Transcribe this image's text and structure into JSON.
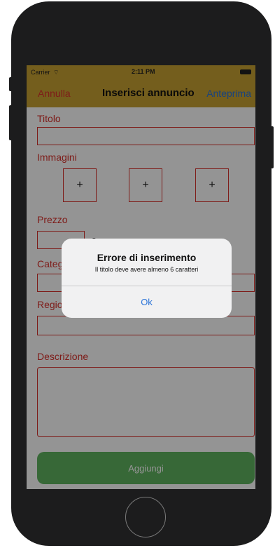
{
  "status_bar": {
    "carrier": "Carrier",
    "time": "2:11 PM"
  },
  "nav": {
    "left": "Annulla",
    "title": "Inserisci annuncio",
    "right": "Anteprima"
  },
  "form": {
    "titolo_label": "Titolo",
    "immagini_label": "Immagini",
    "image_slots": [
      "+",
      "+",
      "+"
    ],
    "prezzo_label": "Prezzo",
    "currency_symbol": "€",
    "categoria_label": "Categoria",
    "regione_label": "Regione",
    "descrizione_label": "Descrizione",
    "submit": "Aggiungi"
  },
  "alert": {
    "title": "Errore di inserimento",
    "message": "Il titolo deve avere almeno 6 caratteri",
    "ok": "Ok"
  },
  "colors": {
    "nav_background": "#c9a233",
    "field_border": "#d9312b",
    "submit_button": "#5fb35f",
    "link_blue": "#2b74d8"
  }
}
